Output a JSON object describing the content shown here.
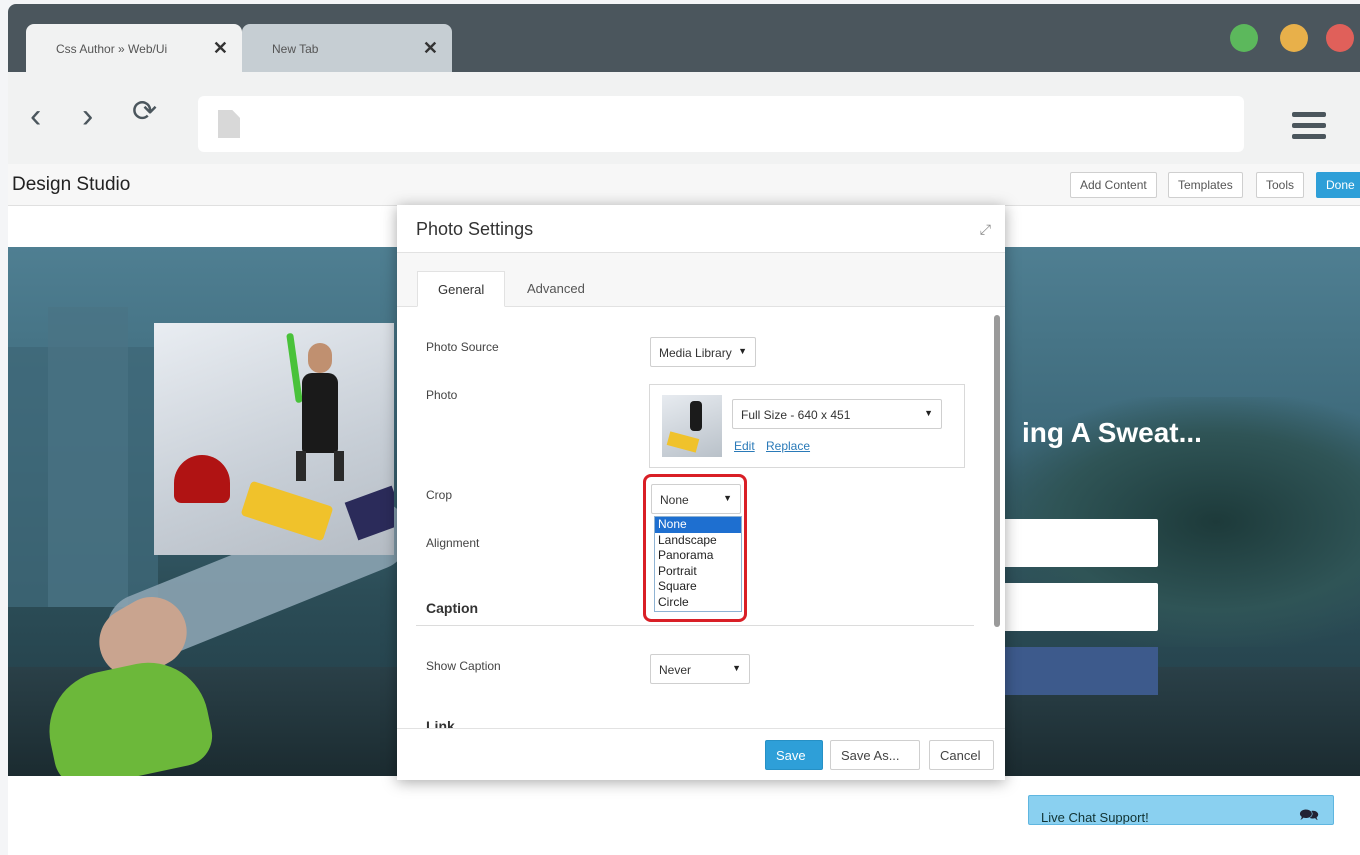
{
  "browser": {
    "tabs": [
      {
        "title": "Css Author » Web/Ui",
        "close": "✕"
      },
      {
        "title": "New Tab",
        "close": "✕"
      }
    ],
    "nav": {
      "back": "‹",
      "forward": "›",
      "reload": "⟳"
    }
  },
  "studio": {
    "title": "Design Studio",
    "buttons": {
      "add_content": "Add Content",
      "templates": "Templates",
      "tools": "Tools",
      "done": "Done"
    }
  },
  "hero": {
    "headline": "ing A Sweat..."
  },
  "modal": {
    "title": "Photo Settings",
    "tabs": {
      "general": "General",
      "advanced": "Advanced"
    },
    "fields": {
      "photo_source_label": "Photo Source",
      "photo_source_value": "Media Library",
      "photo_label": "Photo",
      "photo_size_value": "Full Size - 640 x 451",
      "edit_link": "Edit",
      "replace_link": "Replace",
      "crop_label": "Crop",
      "crop_value": "None",
      "crop_options": [
        "None",
        "Landscape",
        "Panorama",
        "Portrait",
        "Square",
        "Circle"
      ],
      "alignment_label": "Alignment",
      "caption_section": "Caption",
      "show_caption_label": "Show Caption",
      "show_caption_value": "Never",
      "link_section": "Link"
    },
    "footer": {
      "save": "Save",
      "save_as": "Save As...",
      "cancel": "Cancel"
    }
  },
  "chat": {
    "label": "Live Chat Support!"
  },
  "colors": {
    "accent": "#2e9fd8",
    "highlight": "#d91f26",
    "tabstrip": "#4b565d"
  }
}
